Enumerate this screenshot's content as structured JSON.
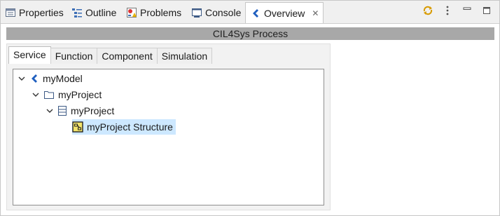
{
  "view_tabs": [
    {
      "label": "Properties",
      "icon": "properties-icon"
    },
    {
      "label": "Outline",
      "icon": "outline-icon"
    },
    {
      "label": "Problems",
      "icon": "problems-icon"
    },
    {
      "label": "Console",
      "icon": "console-icon"
    },
    {
      "label": "Overview",
      "icon": "overview-icon",
      "active": true,
      "closable": true
    }
  ],
  "view_toolbar": [
    "sync-icon",
    "view-menu-icon",
    "minimize-icon",
    "maximize-icon"
  ],
  "process_title": "CIL4Sys Process",
  "inner_tabs": [
    {
      "label": "Service",
      "active": true
    },
    {
      "label": "Function"
    },
    {
      "label": "Component"
    },
    {
      "label": "Simulation"
    }
  ],
  "tree": [
    {
      "label": "myModel",
      "icon": "model-icon",
      "expanded": true,
      "level": 0
    },
    {
      "label": "myProject",
      "icon": "folder-icon",
      "expanded": true,
      "level": 1
    },
    {
      "label": "myProject",
      "icon": "project-icon",
      "expanded": true,
      "level": 2
    },
    {
      "label": "myProject Structure",
      "icon": "structure-icon",
      "selected": true,
      "level": 3
    }
  ],
  "colors": {
    "accent_blue": "#1f5fbf",
    "selection": "#cde8ff",
    "header_gray": "#a8a8a8"
  }
}
